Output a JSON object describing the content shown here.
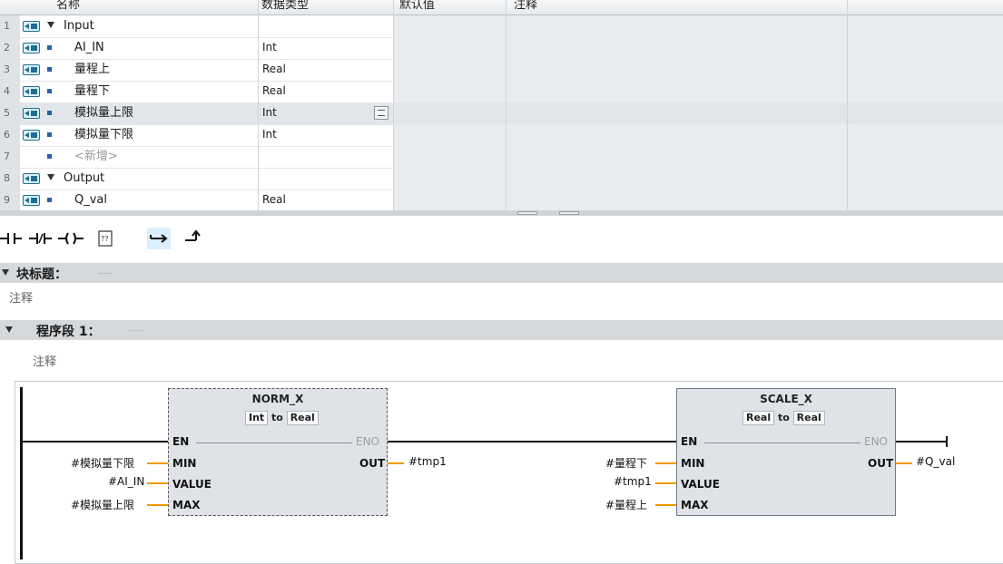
{
  "table": {
    "headers": [
      "名称",
      "数据类型",
      "默认值",
      "注释"
    ],
    "rows": [
      {
        "num": "1",
        "name": "Input",
        "type": "",
        "kind": "section"
      },
      {
        "num": "2",
        "name": "AI_IN",
        "type": "Int",
        "kind": "item"
      },
      {
        "num": "3",
        "name": "量程上",
        "type": "Real",
        "kind": "item"
      },
      {
        "num": "4",
        "name": "量程下",
        "type": "Real",
        "kind": "item"
      },
      {
        "num": "5",
        "name": "模拟量上限",
        "type": "Int",
        "kind": "item",
        "selected": true
      },
      {
        "num": "6",
        "name": "模拟量下限",
        "type": "Int",
        "kind": "item"
      },
      {
        "num": "7",
        "name": "<新增>",
        "type": "",
        "kind": "add"
      },
      {
        "num": "8",
        "name": "Output",
        "type": "",
        "kind": "section"
      },
      {
        "num": "9",
        "name": "Q_val",
        "type": "Real",
        "kind": "item"
      }
    ]
  },
  "toolbar": {
    "items": [
      "normally-open-contact",
      "normally-closed-contact",
      "coil",
      "empty-box",
      "open-branch",
      "close-branch"
    ]
  },
  "block": {
    "title": "块标题：",
    "dots": ".....",
    "comment": "注释"
  },
  "network": {
    "title": "程序段 1：",
    "dots": ".....",
    "comment": "注释",
    "norm_x": {
      "name": "NORM_X",
      "type_in": "Int",
      "type_to": "to",
      "type_out": "Real",
      "pins_in": [
        "EN",
        "MIN",
        "VALUE",
        "MAX"
      ],
      "eno": "ENO",
      "out": "OUT",
      "operands_in": [
        "#模拟量下限",
        "#AI_IN",
        "#模拟量上限"
      ],
      "operand_out": "#tmp1"
    },
    "scale_x": {
      "name": "SCALE_X",
      "type_in": "Real",
      "type_to": "to",
      "type_out": "Real",
      "pins_in": [
        "EN",
        "MIN",
        "VALUE",
        "MAX"
      ],
      "eno": "ENO",
      "out": "OUT",
      "operands_in": [
        "#量程下",
        "#tmp1",
        "#量程上"
      ],
      "operand_out": "#Q_val"
    }
  },
  "colors": {
    "accent": "#f39a00",
    "io_icon": "#1f6f8f",
    "selected_row": "#e2e6eb"
  }
}
